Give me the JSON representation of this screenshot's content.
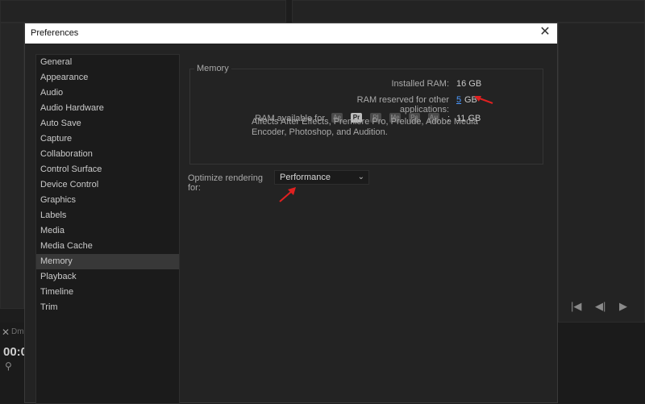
{
  "background": {
    "tab_label": "Dm",
    "timecode": "00:0",
    "playback_icons": [
      "step-back-icon",
      "play-reverse-icon",
      "play-icon"
    ]
  },
  "dialog": {
    "title": "Preferences",
    "sidebar": {
      "items": [
        {
          "label": "General",
          "selected": false
        },
        {
          "label": "Appearance",
          "selected": false
        },
        {
          "label": "Audio",
          "selected": false
        },
        {
          "label": "Audio Hardware",
          "selected": false
        },
        {
          "label": "Auto Save",
          "selected": false
        },
        {
          "label": "Capture",
          "selected": false
        },
        {
          "label": "Collaboration",
          "selected": false
        },
        {
          "label": "Control Surface",
          "selected": false
        },
        {
          "label": "Device Control",
          "selected": false
        },
        {
          "label": "Graphics",
          "selected": false
        },
        {
          "label": "Labels",
          "selected": false
        },
        {
          "label": "Media",
          "selected": false
        },
        {
          "label": "Media Cache",
          "selected": false
        },
        {
          "label": "Memory",
          "selected": true
        },
        {
          "label": "Playback",
          "selected": false
        },
        {
          "label": "Timeline",
          "selected": false
        },
        {
          "label": "Trim",
          "selected": false
        }
      ]
    },
    "memory": {
      "group_label": "Memory",
      "installed_label": "Installed RAM:",
      "installed_value": "16 GB",
      "reserved_label": "RAM reserved for other applications:",
      "reserved_value": "5",
      "reserved_unit": "GB",
      "available_label": "RAM available for",
      "apps": [
        {
          "abbr": "Ae",
          "active": false
        },
        {
          "abbr": "Pr",
          "active": true
        },
        {
          "abbr": "Pl",
          "active": false
        },
        {
          "abbr": "Me",
          "active": false
        },
        {
          "abbr": "Ps",
          "active": false
        },
        {
          "abbr": "Au",
          "active": false
        }
      ],
      "colon": ":",
      "available_value": "11 GB",
      "note": "Affects After Effects, Premiere Pro, Prelude, Adobe Media Encoder, Photoshop, and Audition."
    },
    "optimize": {
      "label": "Optimize rendering for:",
      "value": "Performance"
    }
  },
  "colors": {
    "annotation_arrow": "#e02020",
    "link": "#4c9aff"
  }
}
